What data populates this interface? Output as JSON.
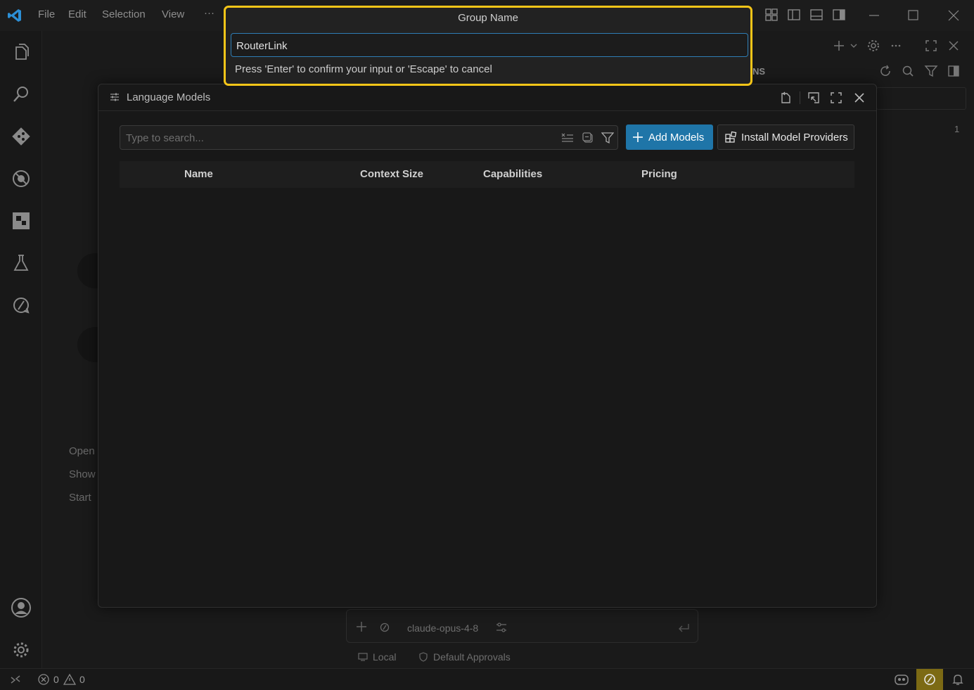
{
  "menu": {
    "file": "File",
    "edit": "Edit",
    "selection": "Selection",
    "view": "View",
    "more": "···"
  },
  "editor_bg": {
    "line1": "Open",
    "line2": "Show",
    "line3": "Start",
    "right_label": "NS",
    "line_number": "1"
  },
  "quick_input": {
    "title": "Group Name",
    "value": "RouterLink",
    "message": "Press 'Enter' to confirm your input or 'Escape' to cancel"
  },
  "modal": {
    "title": "Language Models",
    "search_placeholder": "Type to search...",
    "add_models_label": "Add Models",
    "install_providers_label": "Install Model Providers",
    "columns": {
      "name": "Name",
      "context_size": "Context Size",
      "capabilities": "Capabilities",
      "pricing": "Pricing"
    }
  },
  "chat": {
    "model": "claude-opus-4-8",
    "local_label": "Local",
    "approvals_label": "Default Approvals"
  },
  "status": {
    "errors": "0",
    "warnings": "0"
  },
  "colors": {
    "accent_button": "#1f75a8",
    "highlight_border": "#f5c518",
    "input_focus": "#2e7db5"
  }
}
